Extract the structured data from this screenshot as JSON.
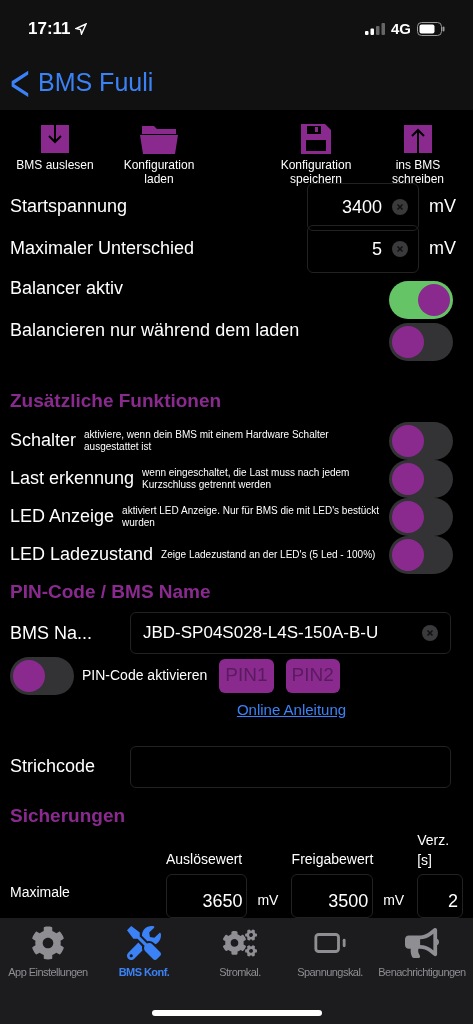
{
  "status_bar": {
    "time": "17:11",
    "network": "4G"
  },
  "nav": {
    "back": "<",
    "title": "BMS Fuuli"
  },
  "toolbar": [
    {
      "kind": "read",
      "label": "BMS auslesen"
    },
    {
      "kind": "load",
      "label": "Konfiguration laden"
    },
    {
      "kind": "save",
      "label": "Konfiguration speichern"
    },
    {
      "kind": "write",
      "label": "ins BMS schreiben"
    }
  ],
  "balance_fields": [
    {
      "label": "Startspannung",
      "value": "3400",
      "unit": "mV"
    },
    {
      "label": "Maximaler Unterschied",
      "value": "5",
      "unit": "mV"
    }
  ],
  "balance_switches": [
    {
      "label": "Balancer aktiv",
      "on": true
    },
    {
      "label": "Balancieren nur während dem laden",
      "on": false
    }
  ],
  "extra": {
    "title": "Zusätzliche Funktionen",
    "items": [
      {
        "label": "Schalter",
        "hint": "aktiviere, wenn dein BMS mit einem Hardware Schalter ausgestattet ist",
        "on": false
      },
      {
        "label": "Last erkennung",
        "hint": "wenn eingeschaltet, die Last muss nach jedem Kurzschluss getrennt werden",
        "on": false
      },
      {
        "label": "LED Anzeige",
        "hint": "aktiviert LED Anzeige. Nur für BMS die mit LED's bestückt wurden",
        "on": false
      },
      {
        "label": "LED Ladezustand",
        "hint": "Zeige Ladezustand an der LED's (5 Led - 100%)",
        "on": false
      }
    ]
  },
  "pin": {
    "title": "PIN-Code / BMS Name",
    "name_label": "BMS Na...",
    "name_value": "JBD-SP04S028-L4S-150A-B-U",
    "pin_switch": {
      "label": "PIN-Code aktivieren",
      "on": false
    },
    "buttons": [
      {
        "label": "PIN1",
        "disabled": true
      },
      {
        "label": "PIN2",
        "disabled": true
      }
    ],
    "link": "Online Anleitung",
    "barcode_label": "Strichcode"
  },
  "protection": {
    "title": "Sicherungen",
    "columns": [
      "Auslösewert",
      "Freigabewert",
      "Verz. [s]"
    ],
    "rows": [
      {
        "label": "Maximale",
        "trigger": "3650",
        "trigger_unit": "mV",
        "release": "3500",
        "release_unit": "mV",
        "delay": "2"
      }
    ]
  },
  "tab_bar": [
    {
      "kind": "settings",
      "label": "App Einstellungen",
      "selected": false
    },
    {
      "kind": "tools",
      "label": "BMS Konf.",
      "selected": true
    },
    {
      "kind": "cogs",
      "label": "Stromkal.",
      "selected": false
    },
    {
      "kind": "battery",
      "label": "Spannungskal.",
      "selected": false
    },
    {
      "kind": "megaphone",
      "label": "Benachrichtigungen",
      "selected": false
    }
  ]
}
